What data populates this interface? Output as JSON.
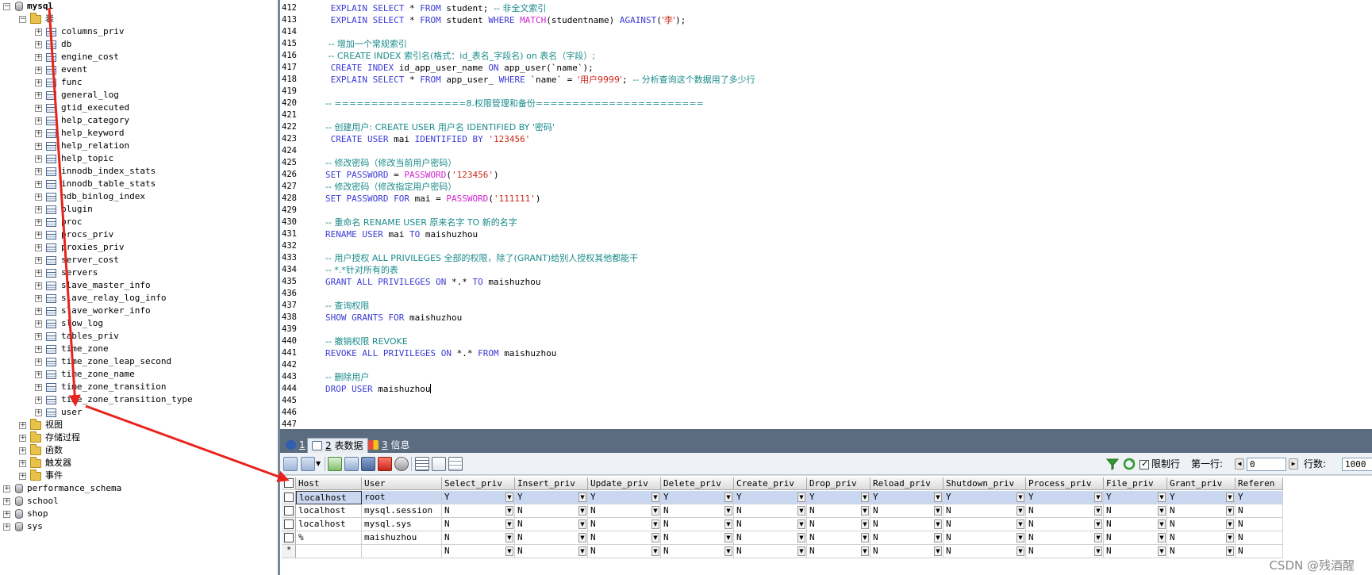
{
  "tree": {
    "root_db": "mysql",
    "tables_folder": "表",
    "tables": [
      "columns_priv",
      "db",
      "engine_cost",
      "event",
      "func",
      "general_log",
      "gtid_executed",
      "help_category",
      "help_keyword",
      "help_relation",
      "help_topic",
      "innodb_index_stats",
      "innodb_table_stats",
      "ndb_binlog_index",
      "plugin",
      "proc",
      "procs_priv",
      "proxies_priv",
      "server_cost",
      "servers",
      "slave_master_info",
      "slave_relay_log_info",
      "slave_worker_info",
      "slow_log",
      "tables_priv",
      "time_zone",
      "time_zone_leap_second",
      "time_zone_name",
      "time_zone_transition",
      "time_zone_transition_type",
      "user"
    ],
    "sub_folders": [
      "视图",
      "存储过程",
      "函数",
      "触发器",
      "事件"
    ],
    "other_dbs": [
      "performance_schema",
      "school",
      "shop",
      "sys"
    ]
  },
  "editor": {
    "line_numbers": [
      "412",
      "413",
      "414",
      "415",
      "416",
      "417",
      "418",
      "419",
      "420",
      "421",
      "422",
      "423",
      "424",
      "425",
      "426",
      "427",
      "428",
      "429",
      "430",
      "431",
      "432",
      "433",
      "434",
      "435",
      "436",
      "437",
      "438",
      "439",
      "440",
      "441",
      "442",
      "443",
      "444",
      "445",
      "446",
      "447"
    ],
    "lines": [
      [
        [
          " EXPLAIN SELECT",
          "kw"
        ],
        [
          " * ",
          ""
        ],
        [
          "FROM",
          "kw"
        ],
        [
          " student; ",
          ""
        ],
        [
          "-- 非全文索引",
          "cm"
        ]
      ],
      [
        [
          " EXPLAIN SELECT",
          "kw"
        ],
        [
          " * ",
          ""
        ],
        [
          "FROM",
          "kw"
        ],
        [
          " student ",
          ""
        ],
        [
          "WHERE",
          "kw"
        ],
        [
          " ",
          ""
        ],
        [
          "MATCH",
          "fn"
        ],
        [
          "(studentname) ",
          ""
        ],
        [
          "AGAINST",
          "kw"
        ],
        [
          "(",
          ""
        ],
        [
          "'李'",
          "st"
        ],
        [
          ");",
          ""
        ]
      ],
      [],
      [
        [
          " -- 增加一个常规索引",
          "cm"
        ]
      ],
      [
        [
          " -- CREATE INDEX 索引名(格式：id_表名_字段名) on 表名（字段）;",
          "cm"
        ]
      ],
      [
        [
          " CREATE INDEX",
          "kw"
        ],
        [
          " id_app_user_name ",
          ""
        ],
        [
          "ON",
          "kw"
        ],
        [
          " app_user(`name`);",
          ""
        ]
      ],
      [
        [
          " EXPLAIN SELECT",
          "kw"
        ],
        [
          " * ",
          ""
        ],
        [
          "FROM",
          "kw"
        ],
        [
          " app_user_ ",
          ""
        ],
        [
          "WHERE",
          "kw"
        ],
        [
          " `name` = ",
          ""
        ],
        [
          "'用户9999'",
          "st"
        ],
        [
          "; ",
          ""
        ],
        [
          "-- 分析查询这个数据用了多少行",
          "cm"
        ]
      ],
      [],
      [
        [
          "-- ==================8.权限管理和备份=======================",
          "cm"
        ]
      ],
      [],
      [
        [
          "-- 创建用户: CREATE USER 用户名 IDENTIFIED BY '密码'",
          "cm"
        ]
      ],
      [
        [
          " CREATE USER",
          "kw"
        ],
        [
          " mai ",
          ""
        ],
        [
          "IDENTIFIED BY",
          "kw"
        ],
        [
          " ",
          ""
        ],
        [
          "'123456'",
          "st"
        ]
      ],
      [],
      [
        [
          "-- 修改密码（修改当前用户密码）",
          "cm"
        ]
      ],
      [
        [
          "SET PASSWORD",
          "kw"
        ],
        [
          " = ",
          ""
        ],
        [
          "PASSWORD",
          "fn"
        ],
        [
          "(",
          ""
        ],
        [
          "'123456'",
          "st"
        ],
        [
          ")",
          ""
        ]
      ],
      [
        [
          "-- 修改密码（修改指定用户密码）",
          "cm"
        ]
      ],
      [
        [
          "SET PASSWORD FOR",
          "kw"
        ],
        [
          " mai = ",
          ""
        ],
        [
          "PASSWORD",
          "fn"
        ],
        [
          "(",
          ""
        ],
        [
          "'111111'",
          "st"
        ],
        [
          ")",
          ""
        ]
      ],
      [],
      [
        [
          "-- 重命名 RENAME USER 原来名字 TO 新的名字",
          "cm"
        ]
      ],
      [
        [
          "RENAME USER",
          "kw"
        ],
        [
          " mai ",
          ""
        ],
        [
          "TO",
          "kw"
        ],
        [
          " maishuzhou",
          ""
        ]
      ],
      [],
      [
        [
          "-- 用户授权 ALL PRIVILEGES 全部的权限，除了(GRANT)给别人授权其他都能干",
          "cm"
        ]
      ],
      [
        [
          "-- *.*针对所有的表",
          "cm"
        ]
      ],
      [
        [
          "GRANT ALL PRIVILEGES ON",
          "kw"
        ],
        [
          " *.* ",
          ""
        ],
        [
          "TO",
          "kw"
        ],
        [
          " maishuzhou",
          ""
        ]
      ],
      [],
      [
        [
          "-- 查询权限",
          "cm"
        ]
      ],
      [
        [
          "SHOW GRANTS FOR",
          "kw"
        ],
        [
          " maishuzhou",
          ""
        ]
      ],
      [],
      [
        [
          "-- 撤销权限 REVOKE",
          "cm"
        ]
      ],
      [
        [
          "REVOKE ALL PRIVILEGES ON",
          "kw"
        ],
        [
          " *.* ",
          ""
        ],
        [
          "FROM",
          "kw"
        ],
        [
          " maishuzhou",
          ""
        ]
      ],
      [],
      [
        [
          "-- 删除用户",
          "cm"
        ]
      ],
      [
        [
          "DROP USER",
          "kw"
        ],
        [
          " maishuzhou",
          ""
        ]
      ],
      [],
      [],
      []
    ]
  },
  "tabs": [
    {
      "num": "1",
      "label": "信息"
    },
    {
      "num": "2",
      "label": "表数据"
    },
    {
      "num": "3",
      "label": "信息"
    }
  ],
  "toolbar": {
    "limit_rows_label": "限制行",
    "first_row_label": "第一行:",
    "first_row_value": "0",
    "row_count_label": "行数:",
    "row_count_value": "1000"
  },
  "grid": {
    "columns": [
      "Host",
      "User",
      "Select_priv",
      "Insert_priv",
      "Update_priv",
      "Delete_priv",
      "Create_priv",
      "Drop_priv",
      "Reload_priv",
      "Shutdown_priv",
      "Process_priv",
      "File_priv",
      "Grant_priv",
      "Referen"
    ],
    "rows": [
      [
        "localhost",
        "root",
        "Y",
        "Y",
        "Y",
        "Y",
        "Y",
        "Y",
        "Y",
        "Y",
        "Y",
        "Y",
        "Y",
        "Y"
      ],
      [
        "localhost",
        "mysql.session",
        "N",
        "N",
        "N",
        "N",
        "N",
        "N",
        "N",
        "N",
        "N",
        "N",
        "N",
        "N"
      ],
      [
        "localhost",
        "mysql.sys",
        "N",
        "N",
        "N",
        "N",
        "N",
        "N",
        "N",
        "N",
        "N",
        "N",
        "N",
        "N"
      ],
      [
        "%",
        "maishuzhou",
        "N",
        "N",
        "N",
        "N",
        "N",
        "N",
        "N",
        "N",
        "N",
        "N",
        "N",
        "N"
      ],
      [
        "",
        "",
        "N",
        "N",
        "N",
        "N",
        "N",
        "N",
        "N",
        "N",
        "N",
        "N",
        "N",
        "N"
      ]
    ],
    "new_row_marker": "*"
  },
  "watermark": "CSDN @残酒醒",
  "colors": {
    "keyword": "#3b3bd6",
    "comment": "#1a8a8a",
    "string": "#cc2a1a",
    "function": "#d024d0",
    "arrow": "#e8231c"
  }
}
